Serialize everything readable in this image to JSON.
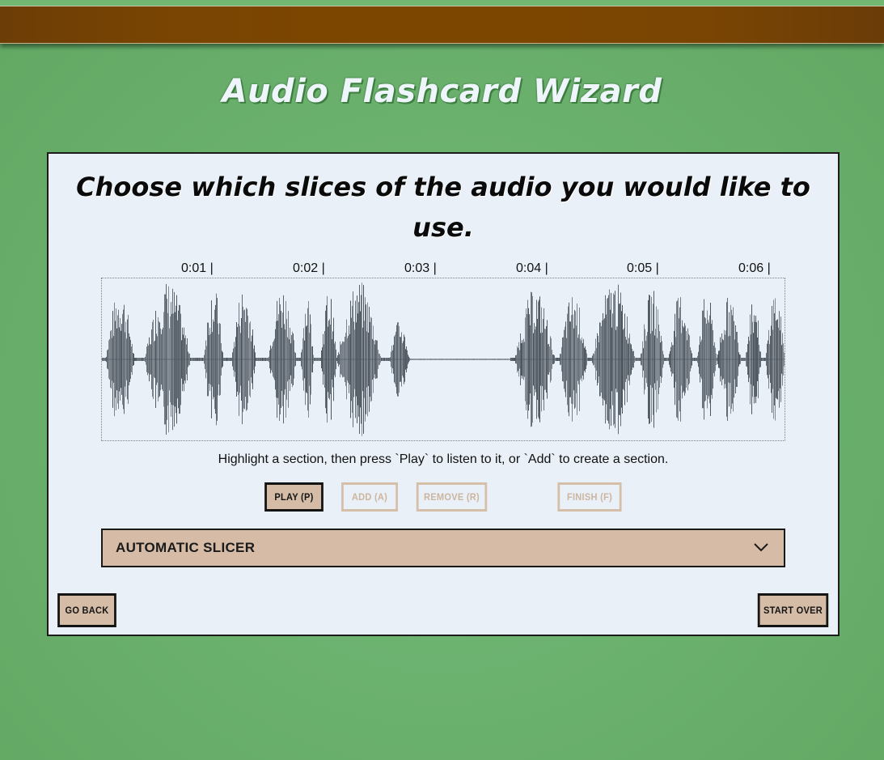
{
  "app": {
    "title": "Audio Flashcard Wizard"
  },
  "step": {
    "heading": "Choose which slices of the audio you would like to use.",
    "timeline_ticks": [
      "0:01 |",
      "0:02 |",
      "0:03 |",
      "0:04 |",
      "0:05 |",
      "0:06 |"
    ],
    "hint": "Highlight a section, then press `Play` to listen to it, or `Add` to create a section."
  },
  "controls": {
    "play_label": "Play (P)",
    "add_label": "Add (A)",
    "remove_label": "Remove (R)",
    "finish_label": "Finish (F)"
  },
  "slicer": {
    "label": "Automatic Slicer"
  },
  "nav": {
    "back_label": "Go back",
    "start_over_label": "Start over"
  },
  "colors": {
    "background": "#6cb26f",
    "wood": "#7d4600",
    "panel": "#e9f0f7",
    "button": "#d5bca7",
    "waveform": "#4a525b"
  }
}
